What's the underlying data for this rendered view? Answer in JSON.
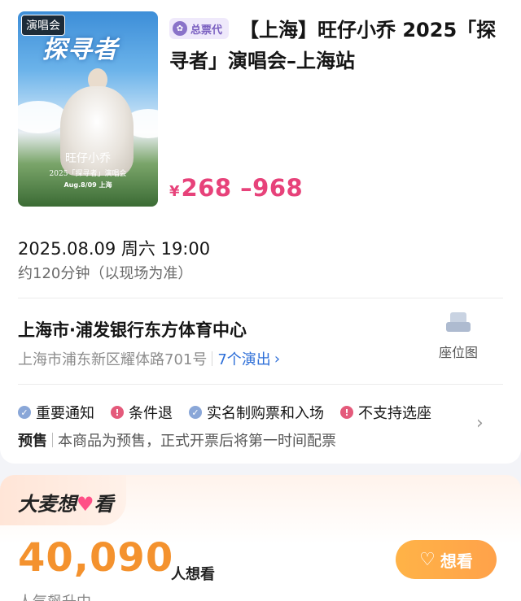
{
  "event": {
    "poster": {
      "tag": "演唱会",
      "title": "探寻者",
      "line1": "旺仔小乔",
      "line2": "2025「探寻者」演唱会",
      "line3": "Aug.8/09 上海"
    },
    "agent_badge": "总票代",
    "title": "【上海】旺仔小乔 2025「探寻者」演唱会–上海站",
    "price_symbol": "¥",
    "price_range": "268 –968",
    "date": "2025.08.09 周六 19:00",
    "duration": "约120分钟（以现场为准）"
  },
  "venue": {
    "name": "上海市·浦发银行东方体育中心",
    "address": "上海市浦东新区耀体路701号",
    "shows": "7个演出",
    "seatmap_label": "座位图"
  },
  "notices": {
    "items": [
      {
        "label": "重要通知",
        "type": "ok"
      },
      {
        "label": "条件退",
        "type": "warn"
      },
      {
        "label": "实名制购票和入场",
        "type": "ok"
      },
      {
        "label": "不支持选座",
        "type": "warn"
      }
    ],
    "presale_tag": "预售",
    "presale_text": "本商品为预售，正式开票后将第一时间配票"
  },
  "wishlist": {
    "title_prefix": "大麦想",
    "title_suffix": "看",
    "count": "40,090",
    "count_suffix": "人想看",
    "popularity": "人气飙升中",
    "button_label": "想看"
  },
  "colors": {
    "price": "#e7427a",
    "count": "#f4922e",
    "link": "#2e6fd8",
    "button": "#ffa24a"
  }
}
